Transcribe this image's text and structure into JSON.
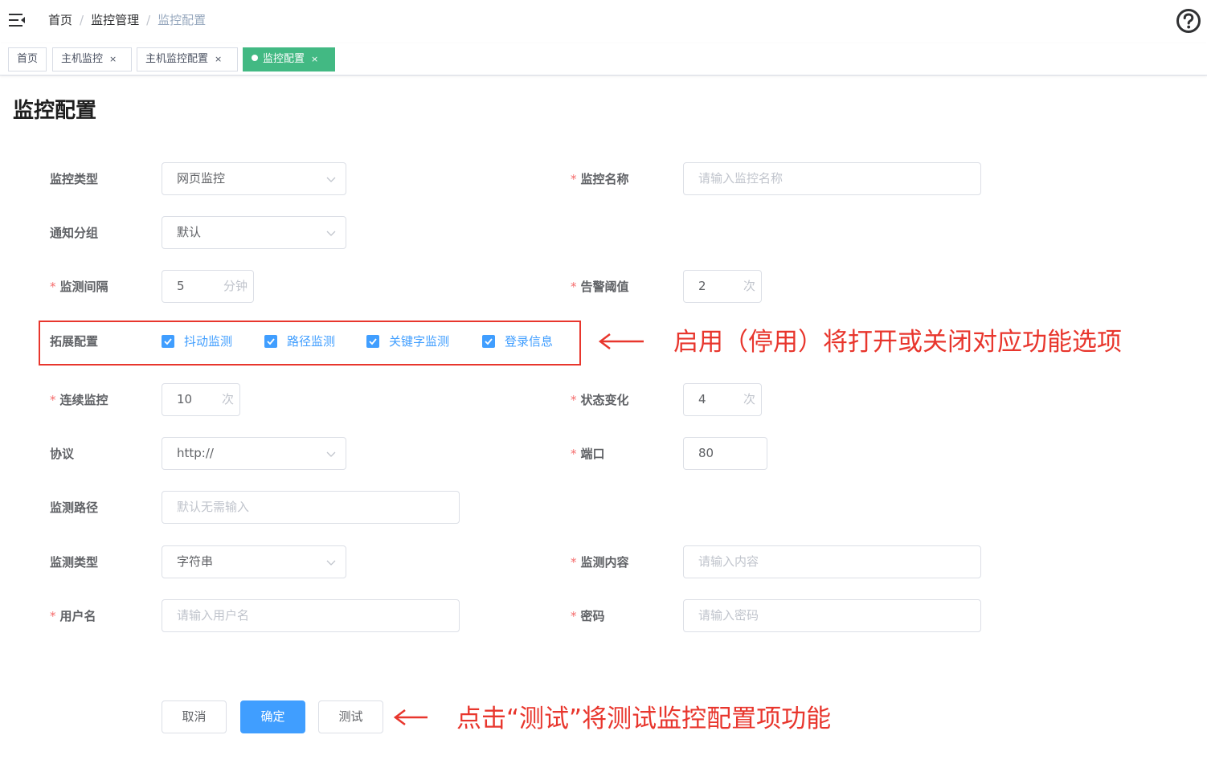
{
  "navbar": {
    "breadcrumb": [
      "首页",
      "监控管理",
      "监控配置"
    ],
    "separator": "/"
  },
  "tags": [
    {
      "label": "首页",
      "closable": false,
      "active": false
    },
    {
      "label": "主机监控",
      "closable": true,
      "active": false
    },
    {
      "label": "主机监控配置",
      "closable": true,
      "active": false
    },
    {
      "label": "监控配置",
      "closable": true,
      "active": true
    }
  ],
  "close_glyph": "×",
  "page_title": "监控配置",
  "form": {
    "monitor_type": {
      "label": "监控类型",
      "value": "网页监控"
    },
    "monitor_name": {
      "label": "监控名称",
      "required": true,
      "placeholder": "请输入监控名称"
    },
    "notify_group": {
      "label": "通知分组",
      "value": "默认"
    },
    "interval": {
      "label": "监测间隔",
      "required": true,
      "value": "5",
      "unit": "分钟"
    },
    "alarm_threshold": {
      "label": "告警阈值",
      "required": true,
      "value": "2",
      "unit": "次"
    },
    "extensions": {
      "label": "拓展配置",
      "options": [
        {
          "label": "抖动监测",
          "checked": true
        },
        {
          "label": "路径监测",
          "checked": true
        },
        {
          "label": "关键字监测",
          "checked": true
        },
        {
          "label": "登录信息",
          "checked": true
        }
      ]
    },
    "continuous": {
      "label": "连续监控",
      "required": true,
      "value": "10",
      "unit": "次"
    },
    "state_change": {
      "label": "状态变化",
      "required": true,
      "value": "4",
      "unit": "次"
    },
    "protocol": {
      "label": "协议",
      "value": "http://"
    },
    "port": {
      "label": "端口",
      "required": true,
      "value": "80"
    },
    "path": {
      "label": "监测路径",
      "placeholder": "默认无需输入"
    },
    "detect_type": {
      "label": "监测类型",
      "value": "字符串"
    },
    "detect_content": {
      "label": "监测内容",
      "required": true,
      "placeholder": "请输入内容"
    },
    "username": {
      "label": "用户名",
      "required": true,
      "placeholder": "请输入用户名"
    },
    "password": {
      "label": "密码",
      "required": true,
      "placeholder": "请输入密码"
    }
  },
  "buttons": {
    "cancel": "取消",
    "confirm": "确定",
    "test": "测试"
  },
  "annotations": {
    "toggle_note": "启用（停用）将打开或关闭对应功能选项",
    "test_note": "点击“测试”将测试监控配置项功能",
    "color": "#e8362d"
  },
  "colors": {
    "primary": "#409eff",
    "active_tag": "#42b983",
    "required": "#f56c6c"
  },
  "icons": {
    "menu": "hamburger-icon",
    "help": "question-circle-icon",
    "arrow": "left-arrow-icon",
    "check": "check-icon",
    "dropdown": "chevron-down-icon"
  }
}
